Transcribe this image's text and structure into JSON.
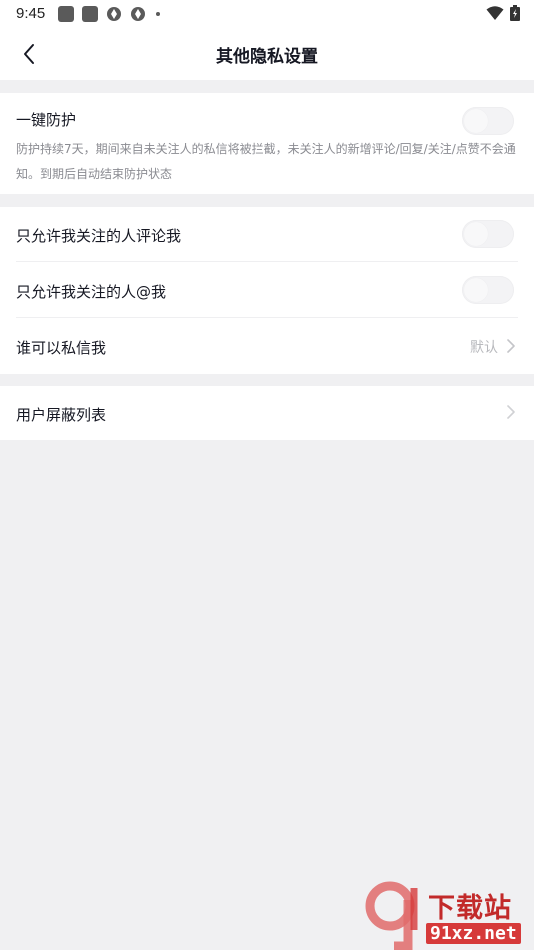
{
  "status_bar": {
    "time": "9:45"
  },
  "header": {
    "title": "其他隐私设置"
  },
  "sections": {
    "protection": {
      "title": "一键防护",
      "description": "防护持续7天，期间来自未关注人的私信将被拦截，未关注人的新增评论/回复/关注/点赞不会通知。到期后自动结束防护状态",
      "enabled": false
    },
    "comments_only_followed": {
      "title": "只允许我关注的人评论我",
      "enabled": false
    },
    "mentions_only_followed": {
      "title": "只允许我关注的人@我",
      "enabled": false
    },
    "who_can_message": {
      "title": "谁可以私信我",
      "value": "默认"
    },
    "blocked_users": {
      "title": "用户屏蔽列表"
    }
  },
  "watermark": {
    "line1": "下载站",
    "line2": "91xz.net"
  },
  "colors": {
    "background": "#f0f0f2",
    "card": "#ffffff",
    "primary_text": "#161823",
    "secondary_text": "#8a8b91",
    "toggle_off": "#f3f3f5",
    "watermark_red": "#d63a3a"
  }
}
